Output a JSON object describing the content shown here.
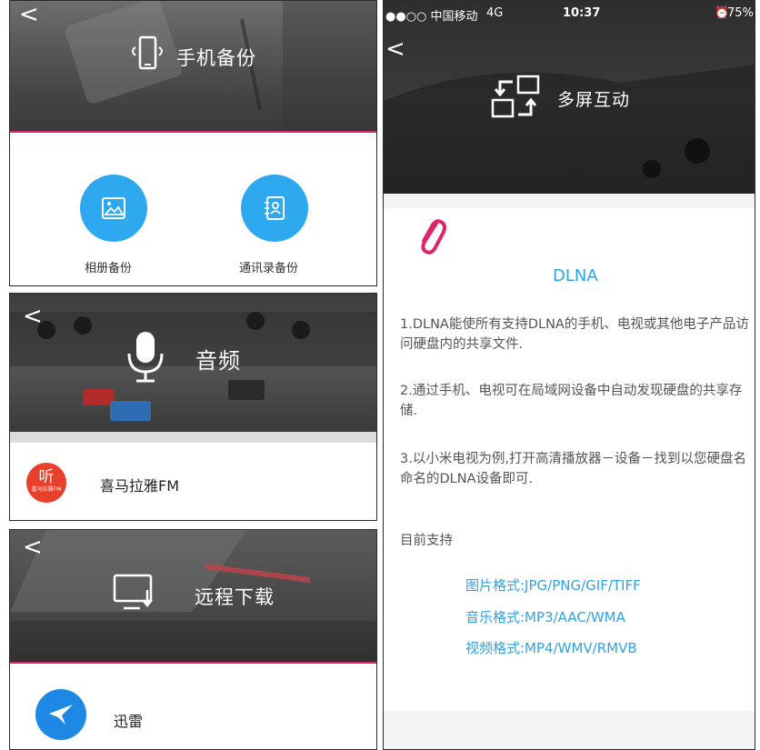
{
  "backup": {
    "title": "手机备份",
    "album_label": "相册备份",
    "contacts_label": "通讯录备份",
    "back_glyph": "<"
  },
  "audio": {
    "title": "音频",
    "back_glyph": "<",
    "item": {
      "label": "喜马拉雅FM",
      "logo_char": "听",
      "logo_caption": "喜马拉雅FM"
    }
  },
  "download": {
    "title": "远程下载",
    "back_glyph": "<",
    "item": {
      "label": "迅雷"
    }
  },
  "multiscreen": {
    "status_bar": {
      "carrier": "●●○○ 中国移动",
      "network": "4G",
      "time": "10:37",
      "battery": "75%",
      "alarm_icon": "alarm-icon"
    },
    "back_glyph": "<",
    "title": "多屏互动",
    "section_title": "DLNA",
    "paragraphs": [
      "1.DLNA能使所有支持DLNA的手机、电视或其他电子产品访问硬盘内的共享文件.",
      "2.通过手机、电视可在局域网设备中自动发现硬盘的共享存储.",
      "3.以小米电视为例,打开高清播放器－设备－找到以您硬盘名命名的DLNA设备即可."
    ],
    "supported_heading": "目前支持",
    "formats": [
      "图片格式:JPG/PNG/GIF/TIFF",
      "音乐格式:MP3/AAC/WMA",
      "视频格式:MP4/WMV/RMVB"
    ]
  },
  "colors": {
    "accent_blue": "#2ea9f0",
    "accent_pink": "#e0246c",
    "xima_red": "#e8402c",
    "link_blue": "#2ea3e8"
  }
}
